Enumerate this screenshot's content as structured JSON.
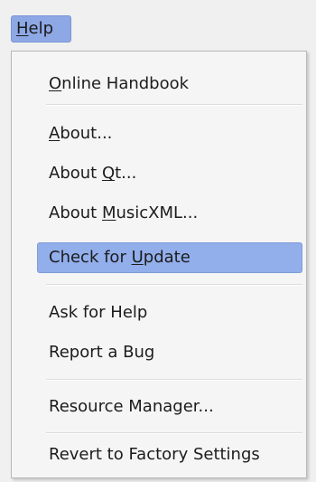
{
  "menubar": {
    "help": {
      "pre": "",
      "mnemonic": "H",
      "post": "elp"
    }
  },
  "menu": {
    "items": [
      {
        "pre": "",
        "mnemonic": "O",
        "post": "nline Handbook"
      },
      {
        "pre": "",
        "mnemonic": "A",
        "post": "bout..."
      },
      {
        "pre": "About ",
        "mnemonic": "Q",
        "post": "t..."
      },
      {
        "pre": "About ",
        "mnemonic": "M",
        "post": "usicXML..."
      },
      {
        "pre": "Check for ",
        "mnemonic": "U",
        "post": "pdate"
      },
      {
        "pre": "Ask for Help",
        "mnemonic": "",
        "post": ""
      },
      {
        "pre": "Report a Bug",
        "mnemonic": "",
        "post": ""
      },
      {
        "pre": "Resource Manager...",
        "mnemonic": "",
        "post": ""
      },
      {
        "pre": "Revert to Factory Settings",
        "mnemonic": "",
        "post": ""
      }
    ],
    "highlighted_index": 4
  },
  "colors": {
    "highlight": "#92aeeb",
    "menubar_highlight": "#8ea8e6",
    "menu_background": "#f5f5f5"
  }
}
